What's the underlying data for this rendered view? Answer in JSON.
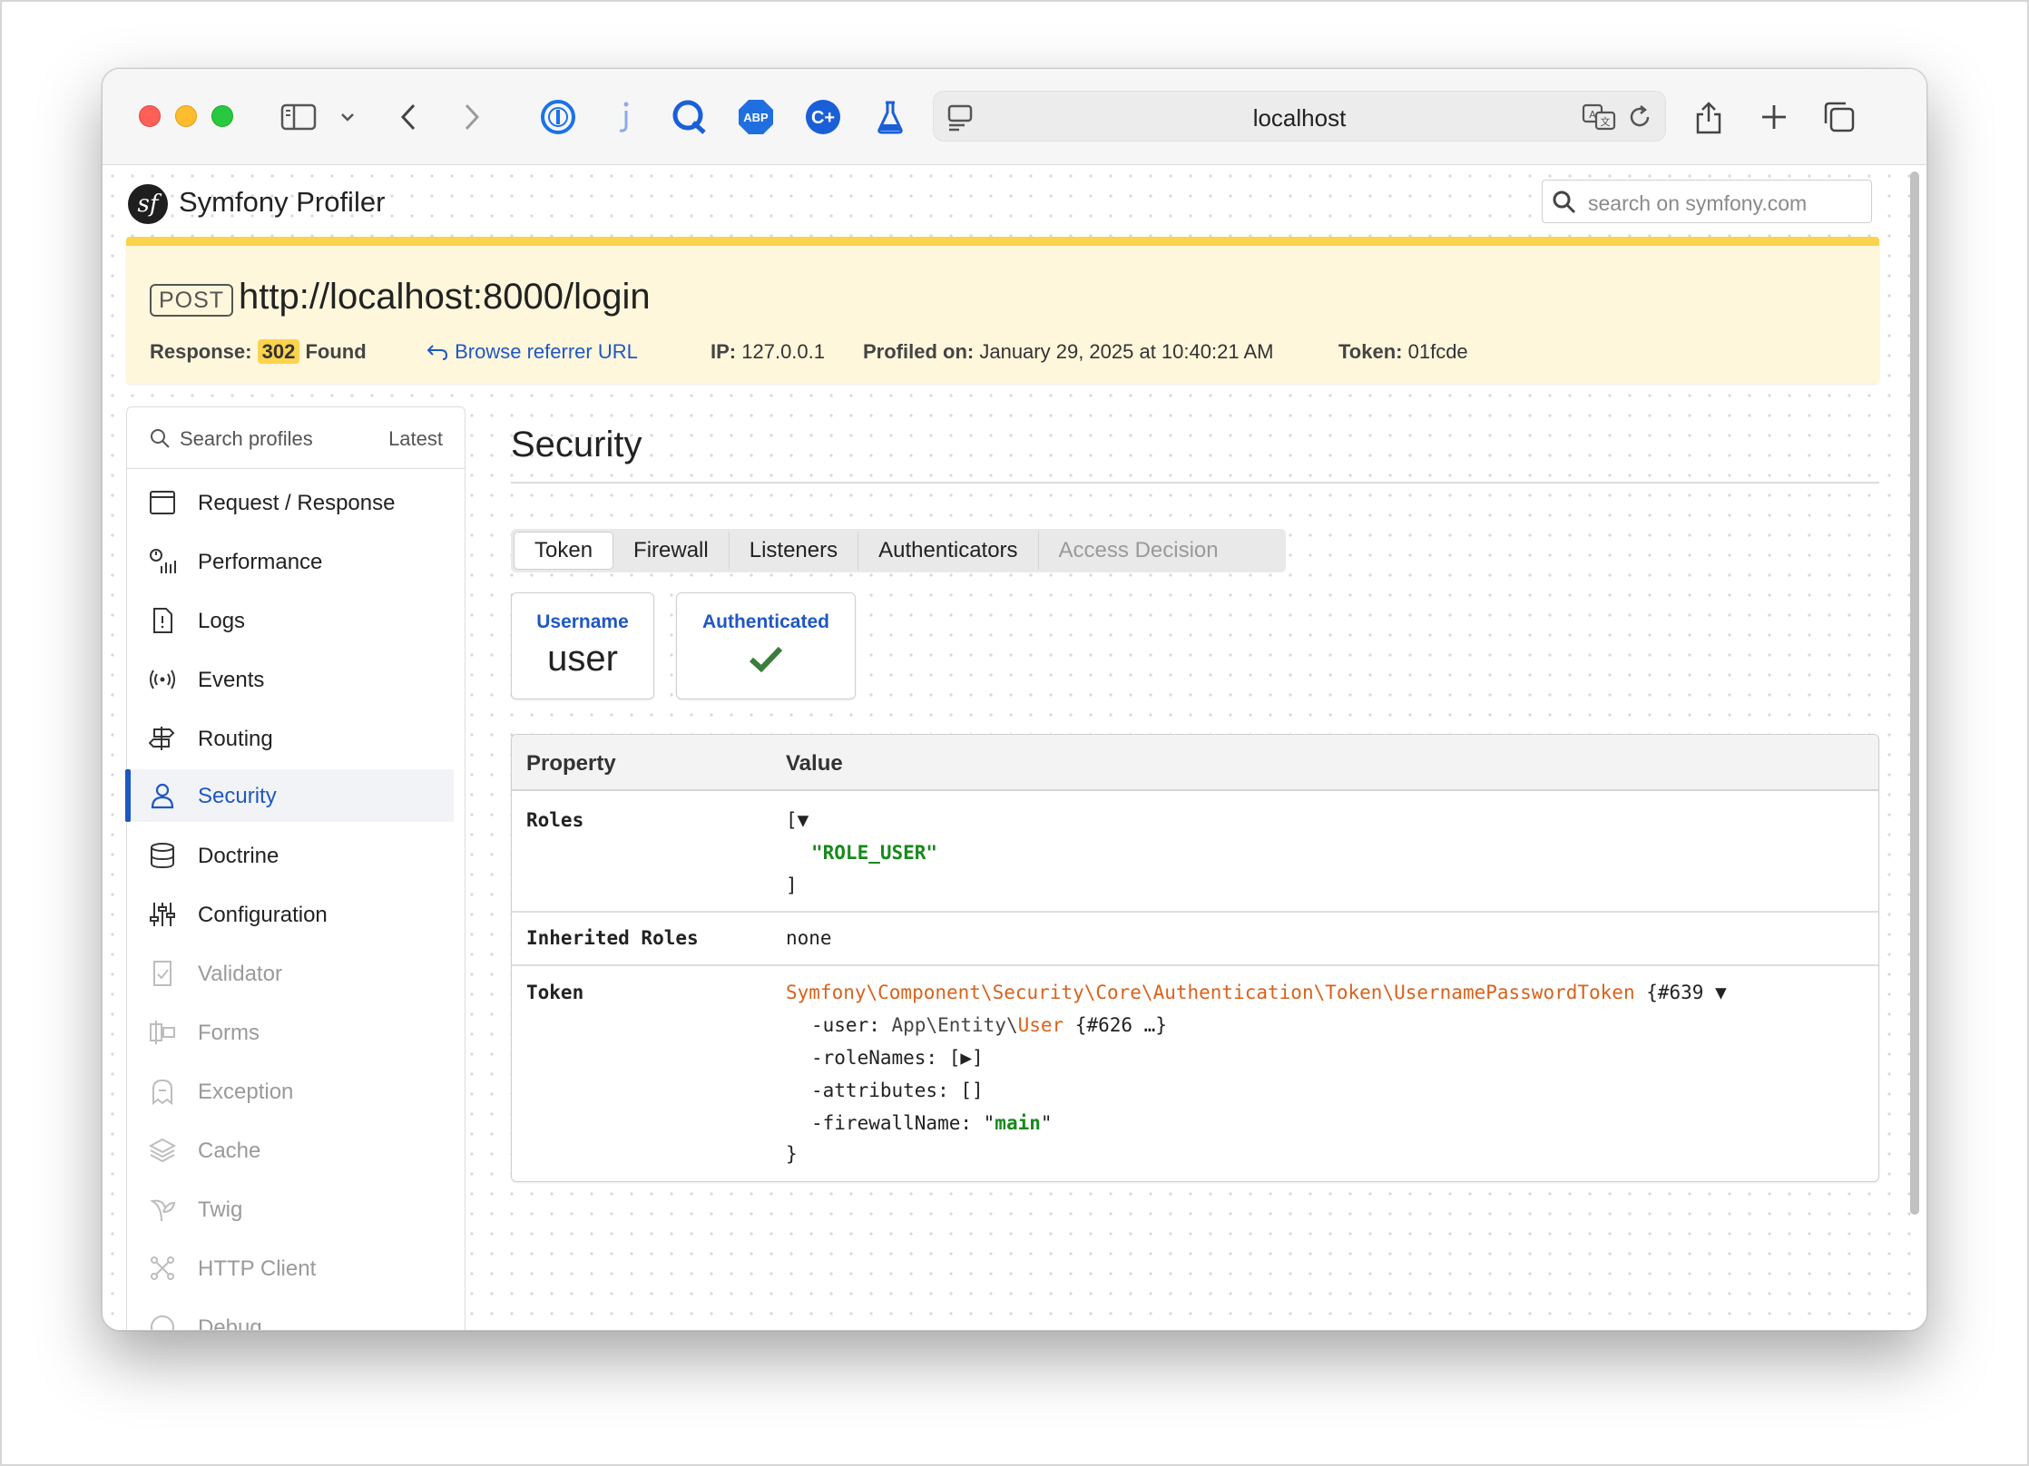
{
  "browser": {
    "url": "localhost"
  },
  "header": {
    "brand": "Symfony Profiler",
    "logo_letter": "sf",
    "search_placeholder": "search on symfony.com"
  },
  "summary": {
    "method": "POST",
    "url": "http://localhost:8000/login",
    "response_label": "Response:",
    "status_code": "302",
    "status_text": "Found",
    "referrer_link": "Browse referrer URL",
    "ip_label": "IP:",
    "ip": "127.0.0.1",
    "profiled_label": "Profiled on:",
    "profiled_on": "January 29, 2025 at 10:40:21 AM",
    "token_label": "Token:",
    "token": "01fcde"
  },
  "sidebar": {
    "search_label": "Search profiles",
    "latest_label": "Latest",
    "items": [
      {
        "label": "Request / Response"
      },
      {
        "label": "Performance"
      },
      {
        "label": "Logs"
      },
      {
        "label": "Events"
      },
      {
        "label": "Routing"
      },
      {
        "label": "Security"
      },
      {
        "label": "Doctrine"
      },
      {
        "label": "Configuration"
      },
      {
        "label": "Validator"
      },
      {
        "label": "Forms"
      },
      {
        "label": "Exception"
      },
      {
        "label": "Cache"
      },
      {
        "label": "Twig"
      },
      {
        "label": "HTTP Client"
      },
      {
        "label": "Debug"
      }
    ]
  },
  "main": {
    "title": "Security",
    "tabs": [
      {
        "label": "Token"
      },
      {
        "label": "Firewall"
      },
      {
        "label": "Listeners"
      },
      {
        "label": "Authenticators"
      },
      {
        "label": "Access Decision"
      }
    ],
    "metrics": [
      {
        "label": "Username",
        "value": "user"
      },
      {
        "label": "Authenticated",
        "value": ""
      }
    ],
    "table": {
      "col_property": "Property",
      "col_value": "Value",
      "roles_key": "Roles",
      "roles_open": "[▼",
      "roles_item": "\"ROLE_USER\"",
      "roles_close": "]",
      "inherited_key": "Inherited Roles",
      "inherited_val": "none",
      "token_key": "Token",
      "token_class": "Symfony\\Component\\Security\\Core\\Authentication\\Token\\UsernamePasswordToken",
      "token_ref": " {#639 ▼",
      "user_prefix": "-user: ",
      "user_ns": "App\\Entity\\",
      "user_class": "User",
      "user_ref": " {#626 …}",
      "role_names": "-roleNames: [▶]",
      "attributes": "-attributes: []",
      "firewall_prefix": "-firewallName: \"",
      "firewall_val": "main",
      "firewall_suffix": "\"",
      "closing": "}"
    }
  },
  "colors": {
    "accent": "#1f57c3",
    "summary_bg": "#fff7dc",
    "summary_bar": "#fbd34d",
    "string": "#178a1c",
    "class": "#d9621a",
    "check": "#3b7d3b"
  }
}
